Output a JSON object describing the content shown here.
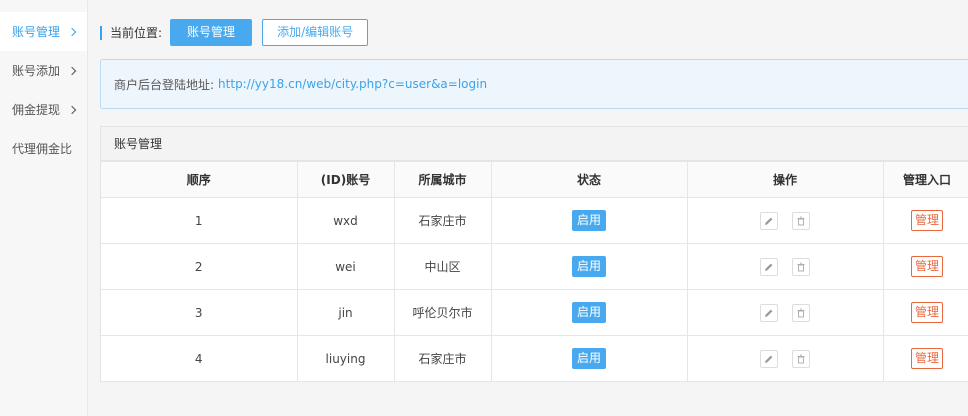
{
  "sidebar": {
    "items": [
      {
        "label": "账号管理",
        "active": true
      },
      {
        "label": "账号添加",
        "active": false
      },
      {
        "label": "佣金提现",
        "active": false
      },
      {
        "label": "代理佣金比",
        "active": false
      }
    ]
  },
  "breadcrumb": {
    "label": "当前位置:",
    "current_button": "账号管理",
    "add_button": "添加/编辑账号"
  },
  "notice": {
    "label": "商户后台登陆地址:",
    "link": "http://yy18.cn/web/city.php?c=user&a=login"
  },
  "panel": {
    "title": "账号管理",
    "columns": [
      "顺序",
      "(ID)账号",
      "所属城市",
      "状态",
      "操作",
      "管理入口"
    ],
    "rows": [
      {
        "order": "1",
        "account": "wxd",
        "city": "石家庄市",
        "status": "启用",
        "manage": "管理"
      },
      {
        "order": "2",
        "account": "wei",
        "city": "中山区",
        "status": "启用",
        "manage": "管理"
      },
      {
        "order": "3",
        "account": "jin",
        "city": "呼伦贝尔市",
        "status": "启用",
        "manage": "管理"
      },
      {
        "order": "4",
        "account": "liuying",
        "city": "石家庄市",
        "status": "启用",
        "manage": "管理"
      }
    ]
  },
  "colors": {
    "accent": "#49a9ee",
    "manage": "#e9683e",
    "notice_bg": "#eef6fd"
  }
}
